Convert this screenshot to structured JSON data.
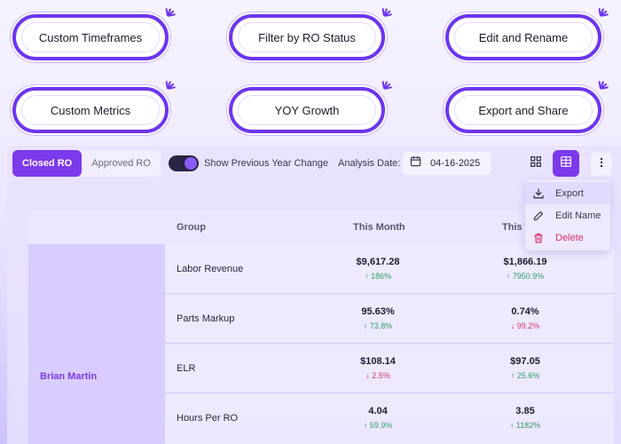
{
  "features": [
    {
      "label": "Custom Timeframes"
    },
    {
      "label": "Filter by RO Status"
    },
    {
      "label": "Edit and Rename"
    },
    {
      "label": "Custom Metrics"
    },
    {
      "label": "YOY Growth"
    },
    {
      "label": "Export and Share"
    }
  ],
  "toolbar": {
    "tabs": [
      {
        "label": "Closed RO",
        "active": true
      },
      {
        "label": "Approved RO",
        "active": false
      }
    ],
    "toggle_label": "Show Previous Year Change",
    "toggle_on": true,
    "date_label": "Analysis Date:",
    "date_value": "04-16-2025"
  },
  "menu": {
    "items": [
      {
        "label": "Export",
        "icon": "download-icon"
      },
      {
        "label": "Edit Name",
        "icon": "pencil-icon"
      },
      {
        "label": "Delete",
        "icon": "trash-icon"
      }
    ]
  },
  "table": {
    "headers": {
      "group": "Group",
      "this_month": "This Month",
      "this_w": "This W"
    },
    "person": "Brian Martin",
    "rows": [
      {
        "group": "Labor Revenue",
        "month": "$9,617.28",
        "month_delta": "↑ 186%",
        "week": "$1,866.19",
        "week_delta": "↑ 7950.9%"
      },
      {
        "group": "Parts Markup",
        "month": "95.63%",
        "month_delta": "↑ 73.8%",
        "week": "0.74%",
        "week_delta": "↓ 99.2%"
      },
      {
        "group": "ELR",
        "month": "$108.14",
        "month_delta": "↓ 2.5%",
        "week": "$97.05",
        "week_delta": "↑ 25.6%"
      },
      {
        "group": "Hours Per RO",
        "month": "4.04",
        "month_delta": "↑ 59.9%",
        "week": "3.85",
        "week_delta": "↑ 1182%"
      }
    ]
  },
  "colors": {
    "accent": "#7c3aed",
    "up": "#2f9e6b",
    "down": "#d6336c"
  }
}
